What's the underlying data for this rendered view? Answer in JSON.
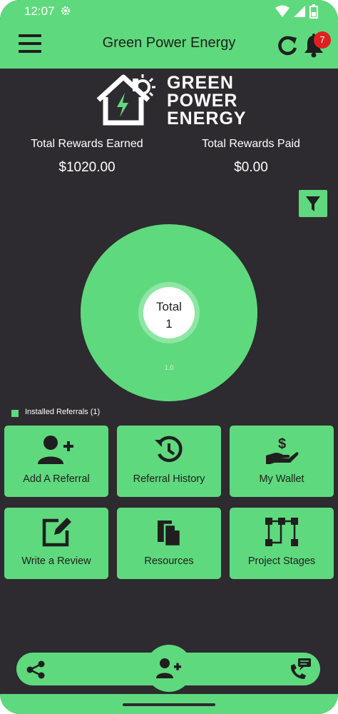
{
  "status_bar": {
    "time": "12:07"
  },
  "app_bar": {
    "title": "Green Power Energy",
    "notification_count": "7"
  },
  "logo": {
    "line1": "GREEN",
    "line2": "POWER",
    "line3": "ENERGY"
  },
  "rewards": {
    "earned_label": "Total Rewards Earned",
    "earned_value": "$1020.00",
    "paid_label": "Total Rewards Paid",
    "paid_value": "$0.00"
  },
  "chart_data": {
    "type": "pie",
    "categories": [
      "Installed Referrals (1)"
    ],
    "values": [
      1
    ],
    "center_label": "Total",
    "center_value": "1",
    "slice_label": "1.0",
    "legend": "Installed Referrals (1)"
  },
  "tiles": [
    {
      "label": "Add A Referral",
      "icon": "add-user-icon"
    },
    {
      "label": "Referral History",
      "icon": "history-icon"
    },
    {
      "label": "My Wallet",
      "icon": "wallet-hand-icon"
    },
    {
      "label": "Write a Review",
      "icon": "edit-icon"
    },
    {
      "label": "Resources",
      "icon": "documents-icon"
    },
    {
      "label": "Project Stages",
      "icon": "project-stages-icon"
    }
  ],
  "colors": {
    "accent": "#5fd97d",
    "background": "#2d2b2f",
    "badge": "#e02020"
  }
}
